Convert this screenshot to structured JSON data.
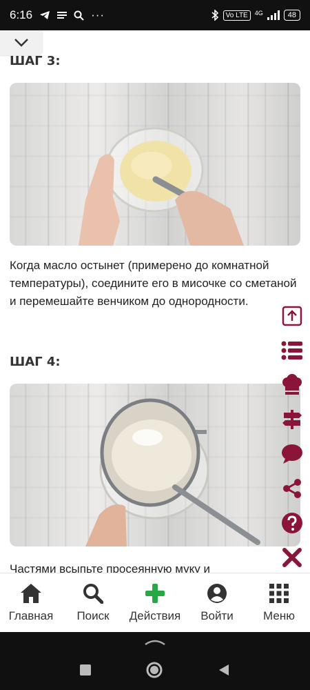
{
  "status_bar": {
    "time": "6:16",
    "net_label": "Vo LTE",
    "signal_label": "4G",
    "battery": "48"
  },
  "steps": [
    {
      "title": "ШАГ 3:",
      "text": "Когда масло остынет (примерено до комнатной температуры), соедините его в мисочке со сметаной и перемешайте венчиком до однородности."
    },
    {
      "title": "ШАГ 4:",
      "text": "Частями всыпьте просеянную муку и"
    }
  ],
  "side_tools": [
    "scroll-up-icon",
    "list-icon",
    "chef-hat-icon",
    "signpost-icon",
    "comment-icon",
    "share-icon",
    "help-icon",
    "close-icon"
  ],
  "bottom_nav": [
    {
      "label": "Главная",
      "icon": "home-icon"
    },
    {
      "label": "Поиск",
      "icon": "search-icon"
    },
    {
      "label": "Действия",
      "icon": "plus-icon"
    },
    {
      "label": "Войти",
      "icon": "user-icon"
    },
    {
      "label": "Меню",
      "icon": "grid-icon"
    }
  ],
  "colors": {
    "accent": "#8b1538",
    "green": "#27a844",
    "nav_icon": "#333333"
  }
}
